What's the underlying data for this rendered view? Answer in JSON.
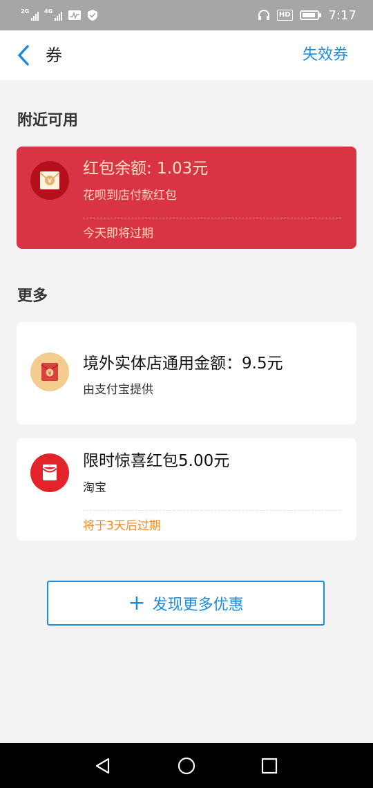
{
  "status_bar": {
    "signal1_label": "2G",
    "signal2_label": "4G",
    "hd_label": "HD",
    "time": "7:17"
  },
  "header": {
    "title": "券",
    "action": "失效券"
  },
  "sections": {
    "nearby": "附近可用",
    "more": "更多"
  },
  "cards": {
    "nearby_card": {
      "icon_symbol": "¥",
      "title": "红包余额: 1.03元",
      "subtitle": "花呗到店付款红包",
      "footer": "今天即将过期"
    },
    "overseas_card": {
      "icon_symbol": "¥",
      "title": "境外实体店通用金额：9.5元",
      "subtitle": "由支付宝提供"
    },
    "surprise_card": {
      "title": "限时惊喜红包5.00元",
      "subtitle": "淘宝",
      "footer": "将于3天后过期"
    }
  },
  "discover_button": {
    "plus": "+",
    "label": "发现更多优惠"
  },
  "colors": {
    "accent": "#1b8be0",
    "card_red": "#d93444",
    "expire_orange": "#f08a24"
  }
}
